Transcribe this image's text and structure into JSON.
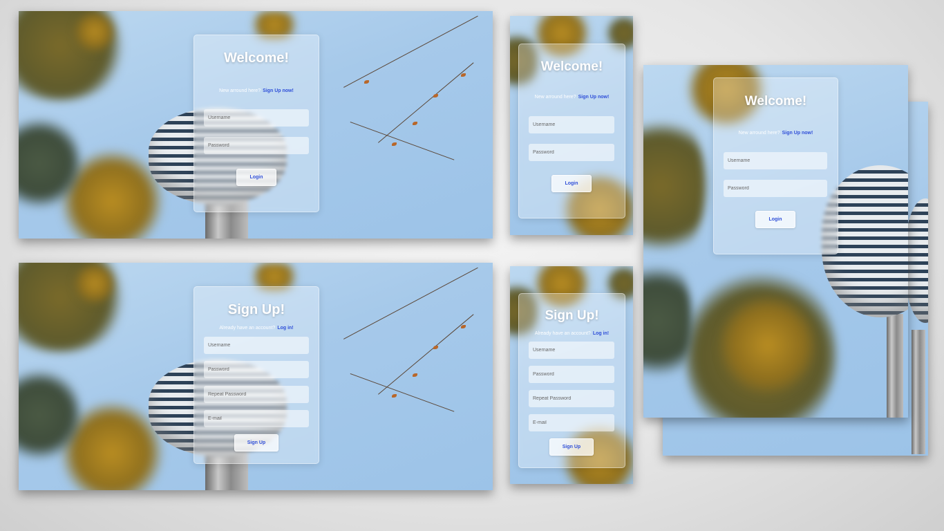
{
  "login": {
    "title": "Welcome!",
    "prompt": "New arround here?",
    "signup_link": "Sign Up now!",
    "username_placeholder": "Username",
    "password_placeholder": "Password",
    "button": "Login"
  },
  "signup": {
    "title": "Sign Up!",
    "prompt": "Already have an account?",
    "login_link": "Log in!",
    "username_placeholder": "Username",
    "password_placeholder": "Password",
    "repeat_password_placeholder": "Repeat Password",
    "email_placeholder": "E-mail",
    "button": "Sign Up"
  },
  "colors": {
    "link": "#2f4fd8",
    "sky": "#a6c9ea",
    "backdrop": "#e6e6e6"
  }
}
